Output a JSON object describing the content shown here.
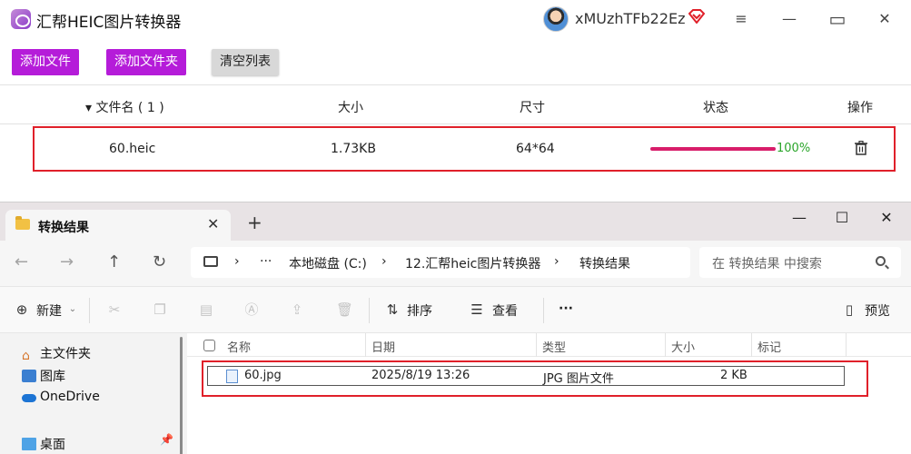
{
  "app": {
    "title": "汇帮HEIC图片转换器",
    "username": "xMUzhTFb22Ez",
    "window_controls": {
      "menu": "≡",
      "minimize": "—",
      "maximize": "▭",
      "close": "✕"
    },
    "toolbar": {
      "add_file": "添加文件",
      "add_folder": "添加文件夹",
      "clear_list": "清空列表"
    },
    "table": {
      "headers": {
        "name": "▾ 文件名 ( 1 )",
        "size": "大小",
        "dimensions": "尺寸",
        "status": "状态",
        "action": "操作"
      },
      "rows": [
        {
          "name": "60.heic",
          "size": "1.73KB",
          "dimensions": "64*64",
          "progress_label": "100%",
          "progress": 1.0
        }
      ]
    },
    "colors": {
      "accent": "#b51cd9",
      "progress": "#d81d6a",
      "done": "#2aa52a",
      "highlight": "#e0202a"
    }
  },
  "explorer": {
    "tab_label": "转换结果",
    "tab_close": "✕",
    "tab_add": "+",
    "window_controls": {
      "minimize": "—",
      "maximize": "☐",
      "close": "✕"
    },
    "nav": {
      "back": "←",
      "forward": "→",
      "up": "↑",
      "refresh": "↻"
    },
    "breadcrumb": {
      "more": "···",
      "drive": "本地磁盘 (C:)",
      "folder": "12.汇帮heic图片转换器",
      "current": "转换结果",
      "sep": "›"
    },
    "search_placeholder": "在 转换结果 中搜索",
    "commands": {
      "new": "新建",
      "sort": "排序",
      "view": "查看",
      "more": "···",
      "preview": "预览"
    },
    "sidebar": {
      "items": [
        {
          "label": "主文件夹",
          "icon": "home-icon"
        },
        {
          "label": "图库",
          "icon": "gallery-icon"
        },
        {
          "label": "OneDrive",
          "icon": "onedrive-icon"
        },
        {
          "label": "桌面",
          "icon": "desktop-icon"
        }
      ]
    },
    "columns": {
      "name": "名称",
      "date": "日期",
      "type": "类型",
      "size": "大小",
      "tags": "标记"
    },
    "files": [
      {
        "name": "60.jpg",
        "date": "2025/8/19 13:26",
        "type": "JPG 图片文件",
        "size": "2 KB"
      }
    ]
  }
}
